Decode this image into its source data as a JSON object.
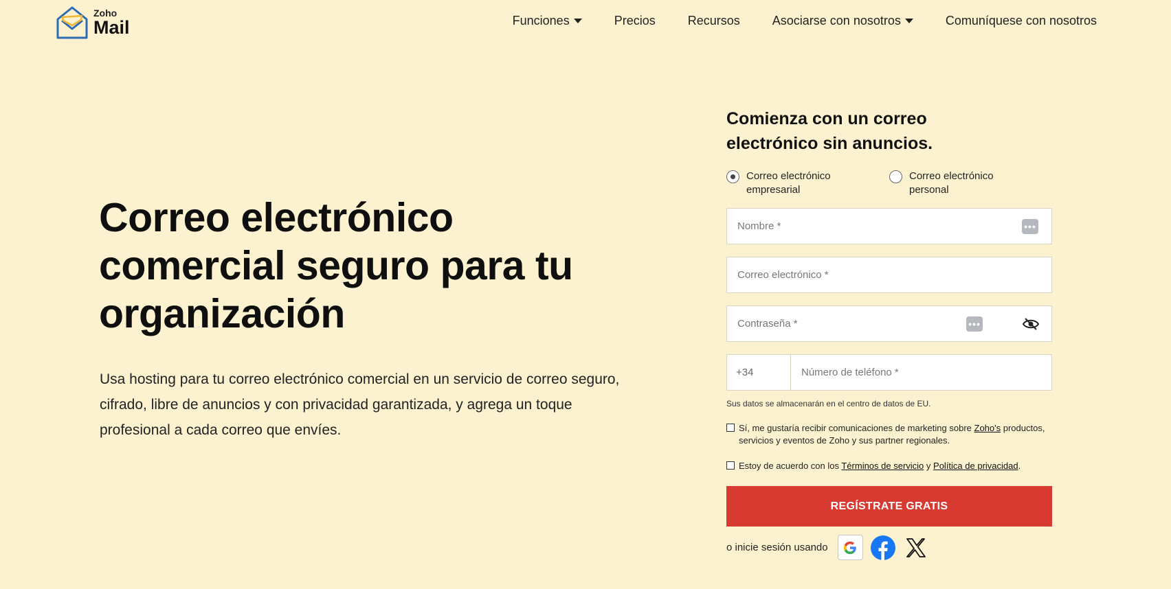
{
  "brand": {
    "small": "Zoho",
    "large": "Mail",
    "accent": "#d63a31",
    "logo_blue": "#2d6bb4",
    "logo_yellow": "#f2b632"
  },
  "nav": [
    {
      "label": "Funciones",
      "dropdown": true
    },
    {
      "label": "Precios",
      "dropdown": false
    },
    {
      "label": "Recursos",
      "dropdown": false
    },
    {
      "label": "Asociarse con nosotros",
      "dropdown": true
    },
    {
      "label": "Comuníquese con nosotros",
      "dropdown": false
    }
  ],
  "hero": {
    "title": "Correo electrónico comercial seguro para tu organización",
    "description": "Usa hosting para tu correo electrónico comercial en un servicio de correo seguro, cifrado, libre de anuncios y con privacidad garantizada, y agrega un toque profesional a cada correo que envíes."
  },
  "form": {
    "title": "Comienza con un correo electrónico sin anuncios.",
    "radio_business": "Correo electrónico empresarial",
    "radio_personal": "Correo electrónico personal",
    "selected": "business",
    "name_placeholder": "Nombre *",
    "email_placeholder": "Correo electrónico *",
    "password_placeholder": "Contraseña *",
    "phone_code": "+34",
    "phone_placeholder": "Número de teléfono *",
    "data_note": "Sus datos se almacenarán en el centro de datos de EU.",
    "marketing_text_1": "Sí, me gustaría recibir comunicaciones de marketing sobre ",
    "marketing_link": "Zoho's",
    "marketing_text_2": " productos, servicios y eventos de Zoho y sus partner regionales.",
    "terms_text_1": "Estoy de acuerdo con los ",
    "terms_link": "Términos de servicio",
    "terms_text_2": " y ",
    "privacy_link": "Política de privacidad",
    "terms_text_3": ".",
    "submit_label": "REGÍSTRATE GRATIS",
    "social_label": "o inicie sesión usando",
    "social": [
      "google-icon",
      "facebook-icon",
      "x-icon"
    ]
  }
}
